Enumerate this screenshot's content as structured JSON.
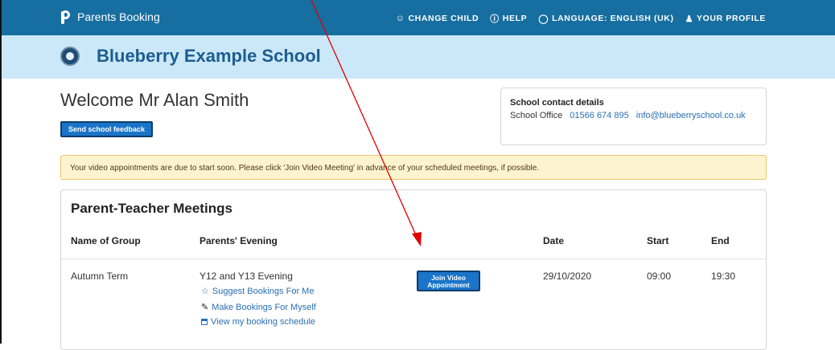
{
  "topbar": {
    "brand": "Parents Booking",
    "links": [
      {
        "icon": "people-icon",
        "label": "CHANGE CHILD"
      },
      {
        "icon": "help-icon",
        "label": "HELP"
      },
      {
        "icon": "globe-icon",
        "label": "LANGUAGE: ENGLISH (UK)"
      },
      {
        "icon": "person-icon",
        "label": "YOUR PROFILE"
      }
    ]
  },
  "school": {
    "name": "Blueberry Example School"
  },
  "welcome": "Welcome Mr Alan Smith",
  "feedback_button": "Send school feedback",
  "contact": {
    "title": "School contact details",
    "label": "School Office",
    "phone": "01566 674 895",
    "email": "info@blueberryschool.co.uk"
  },
  "alert": "Your video appointments are due to start soon. Please click 'Join Video Meeting' in advance of your scheduled meetings, if possible.",
  "meetings": {
    "title": "Parent-Teacher Meetings",
    "headers": {
      "group": "Name of Group",
      "evening": "Parents' Evening",
      "date": "Date",
      "start": "Start",
      "end": "End"
    },
    "row": {
      "group": "Autumn Term",
      "evening": "Y12 and Y13 Evening",
      "actions": [
        {
          "icon": "star-icon",
          "label": "Suggest Bookings For Me"
        },
        {
          "icon": "pencil-icon",
          "label": "Make Bookings For Myself"
        },
        {
          "icon": "calendar-icon",
          "label": "View my booking schedule"
        }
      ],
      "join_button_line1": "Join Video",
      "join_button_line2": "Appointment",
      "date": "29/10/2020",
      "start": "09:00",
      "end": "19:30"
    }
  },
  "colors": {
    "nav": "#176ea0",
    "school_bar": "#cbe8f8",
    "accent": "#1a74c8",
    "arrow": "#e00000"
  }
}
